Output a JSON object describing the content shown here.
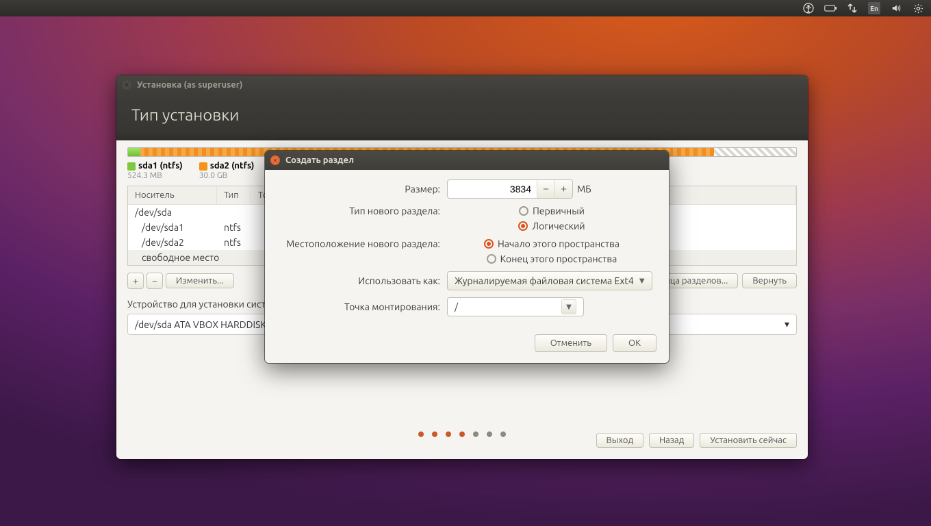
{
  "panel": {
    "lang": "En"
  },
  "installer": {
    "window_title": "Установка (as superuser)",
    "heading": "Тип установки",
    "legend": [
      {
        "name": "sda1 (ntfs)",
        "sub": "524.3 MB",
        "color": "#7ec93e"
      },
      {
        "name": "sda2 (ntfs)",
        "sub": "30.0 GB",
        "color": "#f5921b"
      }
    ],
    "columns": {
      "device": "Носитель",
      "type": "Тип",
      "mount": "Точ"
    },
    "rows": [
      {
        "device": "/dev/sda",
        "type": "",
        "indent": 0,
        "sel": false
      },
      {
        "device": "/dev/sda1",
        "type": "ntfs",
        "indent": 1,
        "sel": false
      },
      {
        "device": "/dev/sda2",
        "type": "ntfs",
        "indent": 1,
        "sel": false
      },
      {
        "device": "свободное место",
        "type": "",
        "indent": 1,
        "sel": true
      }
    ],
    "change_btn": "Изменить...",
    "table_btn": "блица разделов...",
    "revert_btn": "Вернуть",
    "boot_label": "Устройство для установки системного загрузчика:",
    "boot_value": "/dev/sda   ATA VBOX HARDDISK",
    "footer": {
      "quit": "Выход",
      "back": "Назад",
      "install": "Установить сейчас"
    }
  },
  "dialog": {
    "title": "Создать раздел",
    "size_label": "Размер:",
    "size_value": "3834",
    "size_unit": "МБ",
    "type_label": "Тип нового раздела:",
    "type_primary": "Первичный",
    "type_logical": "Логический",
    "location_label": "Местоположение нового раздела:",
    "loc_begin": "Начало этого пространства",
    "loc_end": "Конец этого пространства",
    "use_as_label": "Использовать как:",
    "use_as_value": "Журналируемая файловая система Ext4",
    "mount_label": "Точка монтирования:",
    "mount_value": "/",
    "cancel": "Отменить",
    "ok": "OK"
  }
}
